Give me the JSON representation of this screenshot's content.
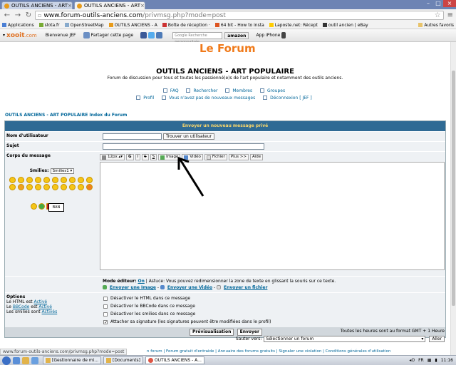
{
  "browser": {
    "tabs": [
      {
        "label": "OUTILS ANCIENS - ART"
      },
      {
        "label": "OUTILS ANCIENS - ART"
      }
    ],
    "url_host": "www.forum-outils-anciens.com",
    "url_path": "/privmsg.php?mode=post",
    "bookmarks": [
      "Applications",
      "slota.fr",
      "OpenStreetMap",
      "OUTILS ANCIENS - A",
      "Boîte de réception ·",
      "64 bit - How to insta",
      "Laposte.net: Récept",
      "outil ancien | eBay"
    ],
    "bookmarks_other": "Autres favoris"
  },
  "xooit": {
    "logo_x": "xooit",
    "logo_dom": ".com",
    "welcome": "Bienvenue JEF",
    "share": "Partager cette page",
    "search_placeholder": "Google Recherche personnalisée",
    "amazon": "amazon",
    "iphone": "App iPhone"
  },
  "page": {
    "logo": "Le Forum",
    "title": "OUTILS ANCIENS - ART POPULAIRE",
    "description": "Forum de discussion pour tous et toutes les passionné(e)s de l'art populaire et notamment des outils anciens.",
    "nav": {
      "faq": "FAQ",
      "search": "Rechercher",
      "members": "Membres",
      "groups": "Groupes",
      "profile": "Profil",
      "messages": "Vous n'avez pas de nouveaux messages",
      "logout": "Déconnexion [ JEF ]"
    },
    "breadcrumb": "OUTILS ANCIENS - ART POPULAIRE Index du Forum"
  },
  "form": {
    "header": "Envoyer un nouveau message privé",
    "username_label": "Nom d'utilisateur",
    "find_user_button": "Trouver un utilisateur",
    "subject_label": "Sujet",
    "body_label": "Corps du message",
    "smilies_label": "Smilies:",
    "smilies_select": "Smilies1",
    "tooltip": "BAN",
    "toolbar": {
      "size": "12px",
      "bold": "G",
      "italic": "I",
      "strike": "S",
      "underline": "S",
      "image": "Image",
      "video": "Vidéo",
      "file": "Fichier",
      "plus": "Plus >>",
      "help": "Aide"
    },
    "mode_prefix": "Mode éditeur:",
    "mode_value": "On",
    "mode_tip": "| Astuce: Vous pouvez redimensionner la zone de texte en glissant la souris sur ce texte.",
    "send_image": "Envoyer une Image",
    "send_video": "Envoyer une Vidéo",
    "send_file": "Envoyer un fichier",
    "options_title": "Options",
    "html_state_prefix": "Le HTML est",
    "html_state": "Activé",
    "bbcode_link": "BBCode",
    "bbcode_state_mid": "est",
    "bbcode_state": "Activé",
    "smilies_state_prefix": "Les smilies sont",
    "smilies_state": "Activés",
    "opts": [
      {
        "label": "Désactiver le HTML dans ce message",
        "checked": false
      },
      {
        "label": "Désactiver le BBCode dans ce message",
        "checked": false
      },
      {
        "label": "Désactiver les smilies dans ce message",
        "checked": false
      },
      {
        "label": "Attacher sa signature (les signatures peuvent être modifiées dans le profil)",
        "checked": true
      }
    ],
    "preview_button": "Prévisualisation",
    "send_button": "Envoyer"
  },
  "footer": {
    "timezone": "Toutes les heures sont au format GMT + 1 Heure",
    "jump_label": "Sauter vers:",
    "jump_select": "Sélectionner un forum",
    "go_button": "Aller",
    "links": "n forum | Forum gratuit d'entraide | Annuaire des forums gratuits | Signaler une violation | Conditions générales d'utilisation",
    "status_url": "www.forum-outils-anciens.com/privmsg.php?mode=post"
  },
  "taskbar": {
    "tasks": [
      "[Gestionnaire de mi...",
      "[Documents]",
      "OUTILS ANCIENS - A..."
    ],
    "lang": "FR",
    "time": "11:16"
  },
  "colors": {
    "header_bg": "#2f6a94",
    "header_text": "#fdd86a",
    "link": "#006699",
    "logo": "#f07a1a"
  }
}
